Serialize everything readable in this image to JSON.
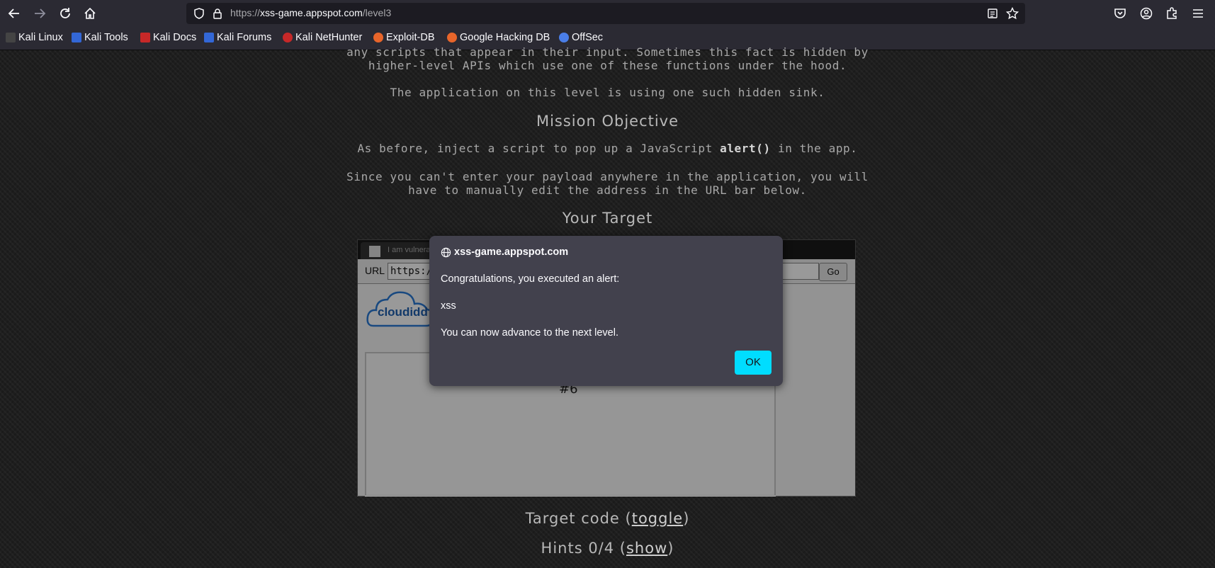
{
  "browser": {
    "url_scheme": "https://",
    "url_host": "xss-game.appspot.com",
    "url_path": "/level3",
    "bookmarks": [
      {
        "label": "Kali Linux",
        "color": "#444444"
      },
      {
        "label": "Kali Tools",
        "color": "#3367d6"
      },
      {
        "label": "Kali Docs",
        "color": "#c62828"
      },
      {
        "label": "Kali Forums",
        "color": "#3367d6"
      },
      {
        "label": "Kali NetHunter",
        "color": "#c62828"
      },
      {
        "label": "Exploit-DB",
        "color": "#e8652a"
      },
      {
        "label": "Google Hacking DB",
        "color": "#e8652a"
      },
      {
        "label": "OffSec",
        "color": "#4a7ee8"
      }
    ]
  },
  "page": {
    "intro_line1": "any scripts that appear in their input. Sometimes this fact is hidden by",
    "intro_line2": "higher-level APIs which use one of these functions under the hood.",
    "intro_line3": "The application on this level is using one such hidden sink.",
    "mission_heading": "Mission Objective",
    "mission_pre": "As before, inject a script to pop up a JavaScript ",
    "mission_code": "alert()",
    "mission_post": " in the app.",
    "payload_line1": "Since you can't enter your payload anywhere in the application, you will",
    "payload_line2": "have to manually edit the address in the URL bar below.",
    "target_heading": "Your Target",
    "target_code_pre": "Target code (",
    "target_code_link": "toggle",
    "target_code_post": ")",
    "hints_pre": "Hints 0/4 (",
    "hints_link": "show",
    "hints_post": ")"
  },
  "frame": {
    "tab_title": "I am vulnera",
    "url_label": "URL",
    "url_value": "https:/",
    "go_label": "Go",
    "logo_text": "cloudidd",
    "content_fragment": "#6"
  },
  "dialog": {
    "origin": "xss-game.appspot.com",
    "message": "Congratulations, you executed an alert:",
    "alert_value": "xss",
    "advance": "You can now advance to the next level.",
    "ok_label": "OK"
  }
}
